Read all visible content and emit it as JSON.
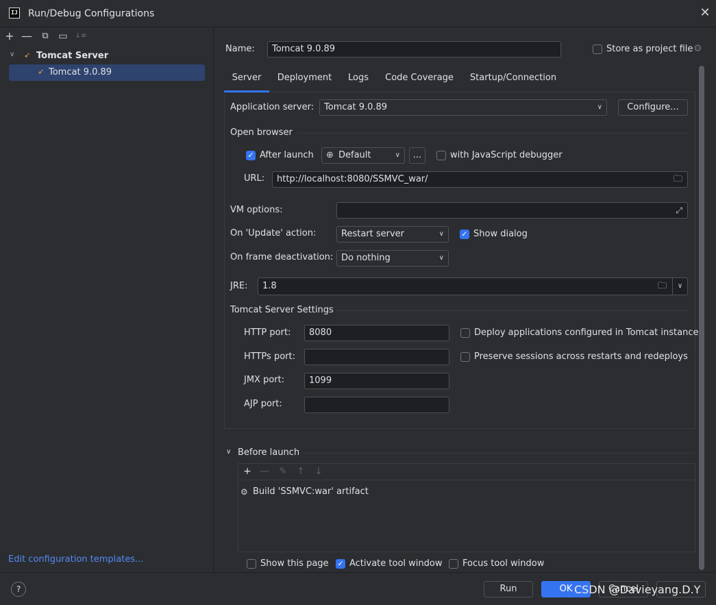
{
  "window": {
    "title": "Run/Debug Configurations",
    "logo_text": "IJ"
  },
  "left": {
    "toolbar": {
      "add": "+",
      "remove": "—",
      "copy": "⧉",
      "folder": "▭",
      "sort": "↓≡"
    },
    "tree": {
      "root_label": "Tomcat Server",
      "child_label": "Tomcat 9.0.89"
    },
    "edit_templates": "Edit configuration templates..."
  },
  "header": {
    "name_label": "Name:",
    "name_value": "Tomcat 9.0.89",
    "store_label": "Store as project file"
  },
  "tabs": [
    {
      "label": "Server"
    },
    {
      "label": "Deployment"
    },
    {
      "label": "Logs"
    },
    {
      "label": "Code Coverage"
    },
    {
      "label": "Startup/Connection"
    }
  ],
  "server": {
    "app_server_label": "Application server:",
    "app_server_value": "Tomcat 9.0.89",
    "configure_label": "Configure...",
    "open_browser_label": "Open browser",
    "after_launch_label": "After launch",
    "after_launch_checked": true,
    "browser_value": "Default",
    "ellipsis": "...",
    "js_debugger_label": "with JavaScript debugger",
    "url_label": "URL:",
    "url_value": "http://localhost:8080/SSMVC_war/",
    "vm_options_label": "VM options:",
    "vm_options_value": "",
    "on_update_label": "On 'Update' action:",
    "on_update_value": "Restart server",
    "show_dialog_label": "Show dialog",
    "on_frame_label": "On frame deactivation:",
    "on_frame_value": "Do nothing",
    "jre_label": "JRE:",
    "jre_value": "1.8",
    "tomcat_settings_label": "Tomcat Server Settings",
    "http_port_label": "HTTP port:",
    "http_port_value": "8080",
    "https_port_label": "HTTPs port:",
    "https_port_value": "",
    "jmx_port_label": "JMX port:",
    "jmx_port_value": "1099",
    "ajp_port_label": "AJP port:",
    "ajp_port_value": "",
    "deploy_label": "Deploy applications configured in Tomcat instance",
    "preserve_label": "Preserve sessions across restarts and redeploys"
  },
  "before_launch": {
    "label": "Before launch",
    "toolbar": {
      "add": "+",
      "remove": "—",
      "edit": "✎",
      "up": "↑",
      "down": "↓"
    },
    "item": "Build 'SSMVC:war' artifact",
    "show_page_label": "Show this page",
    "activate_label": "Activate tool window",
    "focus_label": "Focus tool window"
  },
  "footer": {
    "help": "?",
    "run": "Run",
    "ok": "OK",
    "cancel": "Cancel",
    "watermark": "CSDN @Davieyang.D.Y"
  },
  "colors": {
    "accent": "#3574f0",
    "background": "#2b2d30",
    "input_bg": "#1e1f22",
    "selection": "#2e436e",
    "link": "#548af7"
  }
}
